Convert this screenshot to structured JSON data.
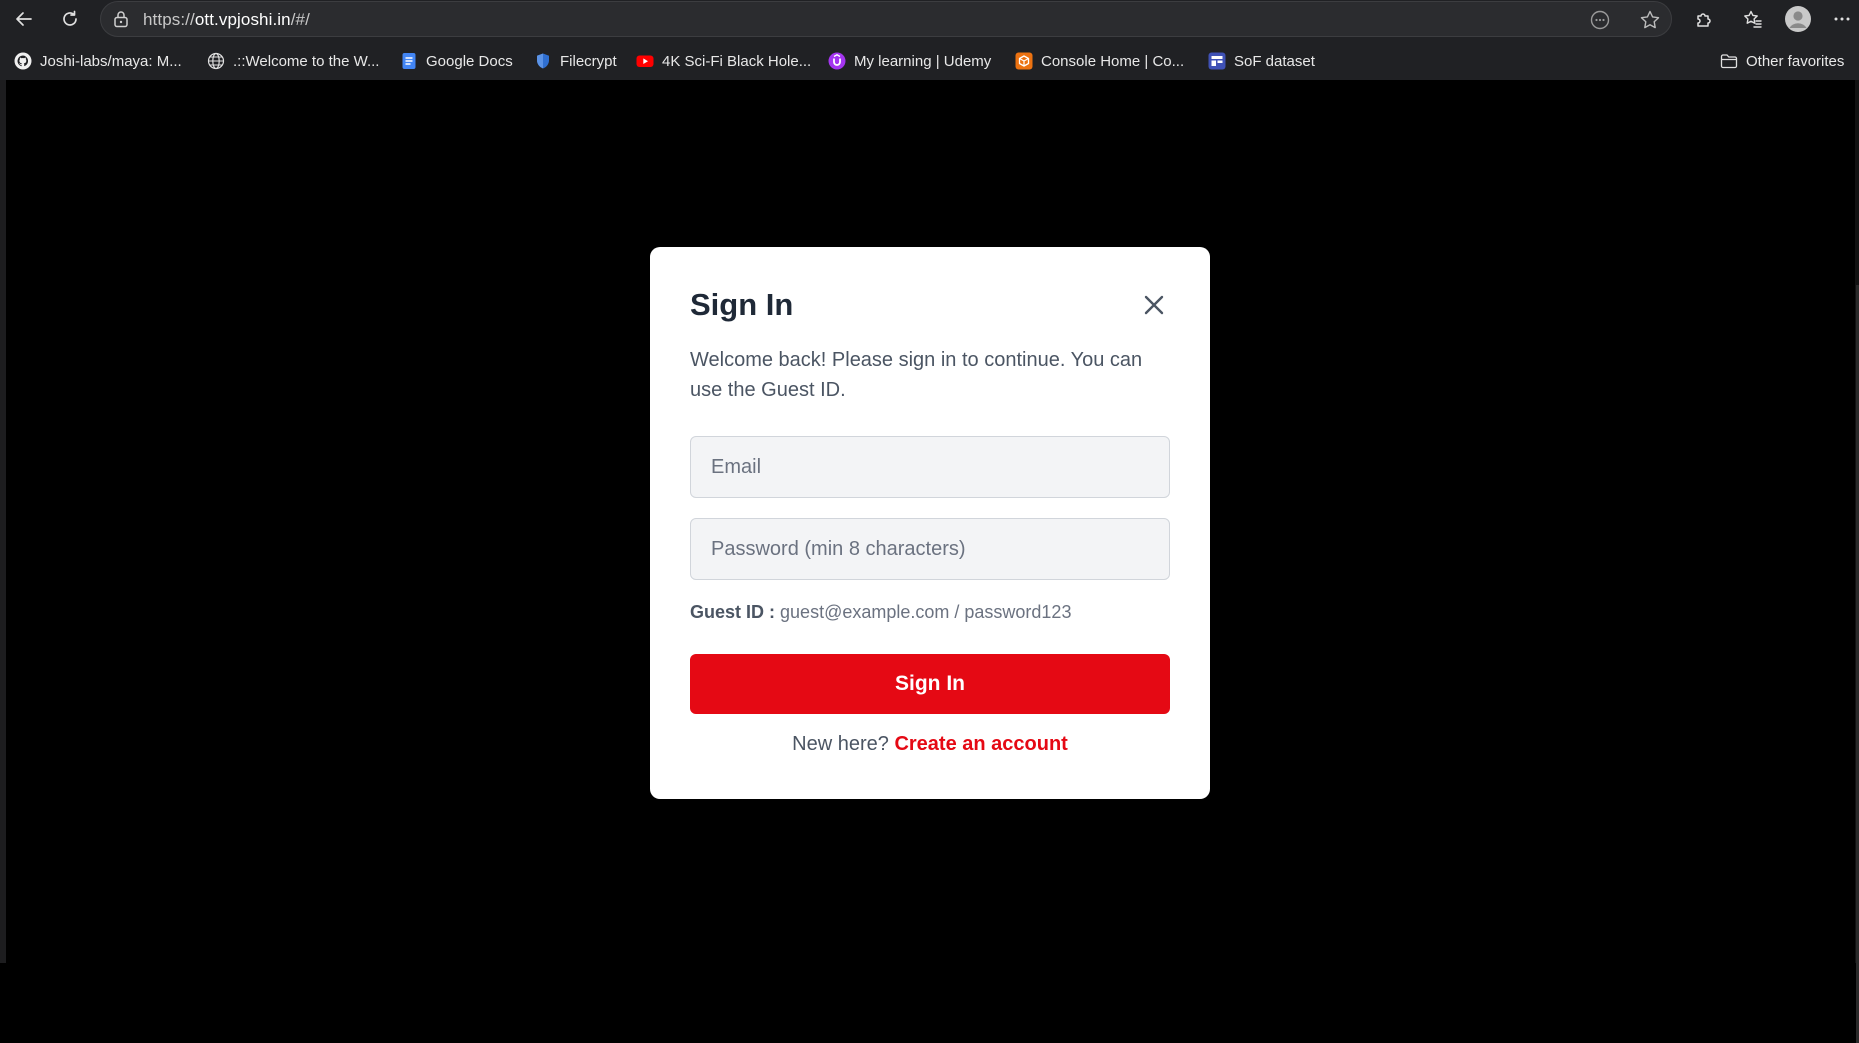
{
  "browser": {
    "url_scheme": "https://",
    "url_host": "ott.vpjoshi.in",
    "url_path": "/#/",
    "bookmarks": [
      {
        "label": "Joshi-labs/maya: M...",
        "icon": "github-icon"
      },
      {
        "label": ".::Welcome to the W...",
        "icon": "globe-icon"
      },
      {
        "label": "Google Docs",
        "icon": "google-docs-icon"
      },
      {
        "label": "Filecrypt",
        "icon": "shield-icon"
      },
      {
        "label": "4K Sci-Fi Black Hole...",
        "icon": "youtube-icon"
      },
      {
        "label": "My learning | Udemy",
        "icon": "udemy-icon"
      },
      {
        "label": "Console Home | Co...",
        "icon": "aws-icon"
      },
      {
        "label": "SoF dataset",
        "icon": "dataset-icon"
      }
    ],
    "other_favorites": "Other favorites"
  },
  "modal": {
    "title": "Sign In",
    "subtitle": "Welcome back! Please sign in to continue. You can use the Guest ID.",
    "email_placeholder": "Email",
    "password_placeholder": "Password (min 8 characters)",
    "guest_label": "Guest ID :",
    "guest_value": "guest@example.com / password123",
    "submit_label": "Sign In",
    "footer_text": "New here?",
    "footer_link": "Create an account"
  },
  "colors": {
    "accent": "#e50914",
    "backdrop": "#000000",
    "modal_bg": "#ffffff"
  }
}
